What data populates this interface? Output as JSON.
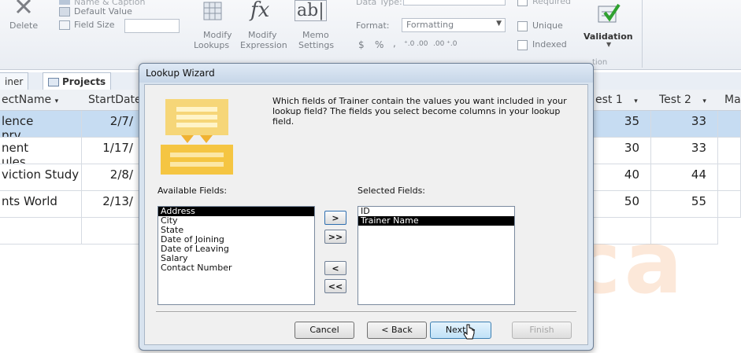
{
  "ribbon": {
    "delete_label": "Delete",
    "name_caption": "Name & Caption",
    "default_value": "Default Value",
    "field_size": "Field Size",
    "modify_lookups": [
      "Modify",
      "Lookups"
    ],
    "modify_expression": [
      "Modify",
      "Expression"
    ],
    "memo_settings": [
      "Memo",
      "Settings"
    ],
    "memo_icon": "ab|",
    "fx_icon": "fx",
    "data_type_label": "Data Type:",
    "format_label": "Format:",
    "format_value": "Formatting",
    "dollar": "$",
    "percent": "%",
    "comma": ",",
    "inc_decimals": "⁺.0 .00",
    "dec_decimals": ".00 ⁺.0",
    "required": "Required",
    "unique": "Unique",
    "indexed": "Indexed",
    "validation": "Validation",
    "validation_suffix": "tion"
  },
  "tabs": {
    "trainer": "iner",
    "projects": "Projects"
  },
  "grid": {
    "headers": [
      "ectName",
      "StartDate",
      "est 1",
      "Test 2",
      "Ma"
    ],
    "rows": [
      {
        "name": "lence",
        "name2": "prv",
        "date": "2/7/",
        "test1": "35",
        "test2": "33"
      },
      {
        "name": "nent",
        "name2": "ules",
        "date": "1/17/",
        "test1": "30",
        "test2": "33"
      },
      {
        "name": "viction Study",
        "name2": "",
        "date": "2/8/",
        "test1": "40",
        "test2": "44"
      },
      {
        "name": "nts World",
        "name2": "",
        "date": "2/13/",
        "test1": "50",
        "test2": "55"
      }
    ]
  },
  "wizard": {
    "title": "Lookup Wizard",
    "question": "Which fields of Trainer contain the values you want included in your lookup field? The fields you select become columns in your lookup field.",
    "available_label": "Available Fields:",
    "selected_label": "Selected Fields:",
    "available_fields": [
      "Address",
      "City",
      "State",
      "Date of Joining",
      "Date of Leaving",
      "Salary",
      "Contact Number"
    ],
    "selected_fields": [
      "ID",
      "Trainer Name"
    ],
    "move_one": ">",
    "move_all": ">>",
    "remove_one": "<",
    "remove_all": "<<",
    "cancel": "Cancel",
    "back": "< Back",
    "next": "Next >",
    "finish": "Finish"
  },
  "watermark": "niteq Aca",
  "colors": {
    "selection_row": "#c6dcf2",
    "list_highlight": "#000000",
    "wizard_accent": "#f5c542"
  }
}
